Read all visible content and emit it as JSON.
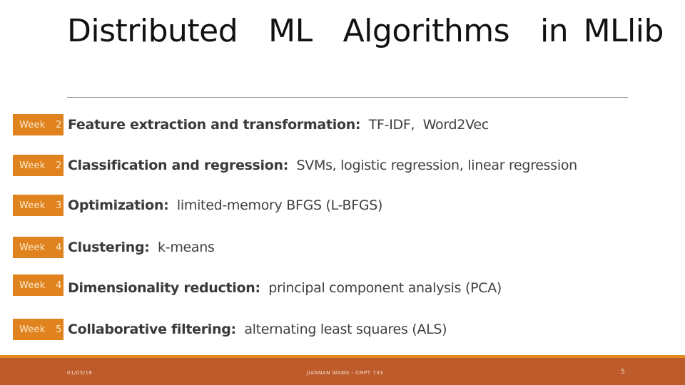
{
  "slide": {
    "title": "Distributed  ML  Algorithms  in MLlib",
    "items": [
      {
        "week": "Week  2",
        "heading": "Feature extraction and transformation:",
        "detail": "  TF-IDF,  Word2Vec"
      },
      {
        "week": "Week  2",
        "heading": "Classification and regression:",
        "detail": "  SVMs, logistic regression, linear regression"
      },
      {
        "week": "Week  3",
        "heading": "Optimization:",
        "detail": "  limited-memory BFGS (L-BFGS)"
      },
      {
        "week": "Week  4",
        "heading": "Clustering:",
        "detail": "  k-means"
      },
      {
        "week": "Week  4",
        "heading": "Dimensionality reduction:",
        "detail": "  principal component analysis (PCA)"
      },
      {
        "week": "Week  5",
        "heading": "Collaborative filtering:",
        "detail": "  alternating least squares (ALS)"
      }
    ]
  },
  "footer": {
    "date": "01/05/16",
    "author": "JIANNAN WANG - CMPT 733",
    "page_number": "5"
  },
  "colors": {
    "badge": "#e0821d",
    "footer_band": "#bd5b2b",
    "footer_line": "#e38a1c"
  }
}
